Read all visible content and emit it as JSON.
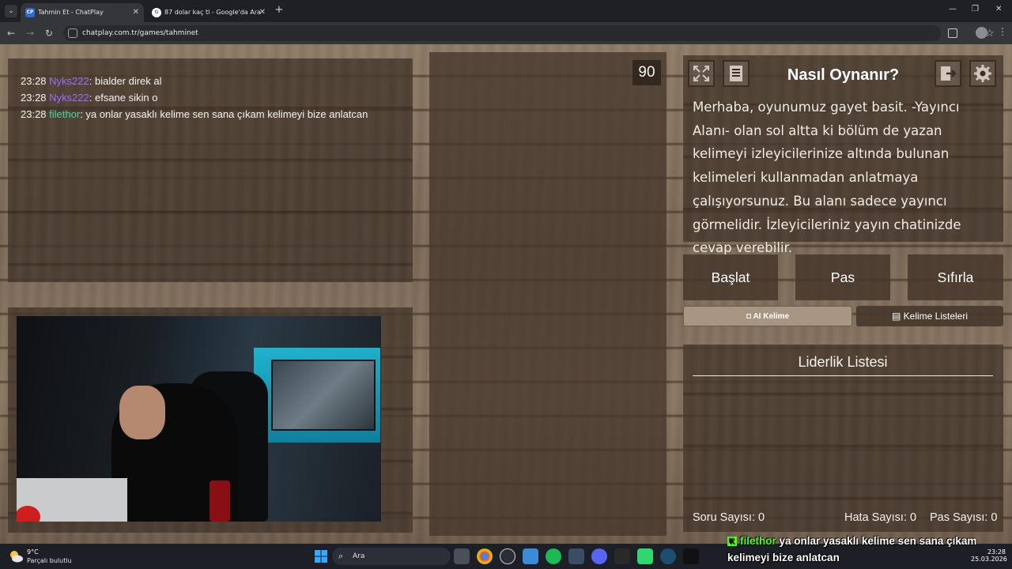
{
  "browser": {
    "tabs": [
      {
        "title": "Tahmin Et - ChatPlay",
        "favicon": "CP"
      },
      {
        "title": "87 dolar kaç tl - Google'da Ara",
        "favicon": "G"
      }
    ],
    "url": "chatplay.com.tr/games/tahminet"
  },
  "chat": {
    "messages": [
      {
        "time": "23:28",
        "user": "Nyks222",
        "user_color": "#a36bff",
        "text": ": bialder direk al"
      },
      {
        "time": "23:28",
        "user": "Nyks222",
        "user_color": "#a36bff",
        "text": ": efsane sikin o"
      },
      {
        "time": "23:28",
        "user": "filethor",
        "user_color": "#3fd7a6",
        "text": ": ya onlar yasaklı kelime sen sana çıkam kelimeyi bize anlatcan"
      }
    ]
  },
  "timer": "90",
  "help": {
    "title": "Nasıl Oynanır?",
    "text": "Merhaba, oyunumuz gayet basit. -Yayıncı Alanı- olan sol altta ki bölüm de yazan kelimeyi izleyicilerinize altında bulunan kelimeleri kullanmadan anlatmaya çalışıyorsunuz. Bu alanı sadece yayıncı görmelidir. İzleyicileriniz yayın chatinizde cevap verebilir."
  },
  "actions": {
    "start": "Başlat",
    "pass": "Pas",
    "reset": "Sıfırla"
  },
  "sub_actions": {
    "ai_word": "AI Kelime",
    "word_lists": "Kelime Listeleri"
  },
  "leaderboard": {
    "title": "Liderlik Listesi",
    "question_count_label": "Soru Sayısı:",
    "question_count": "0",
    "error_count_label": "Hata Sayısı:",
    "error_count": "0",
    "pass_count_label": "Pas Sayısı:",
    "pass_count": "0"
  },
  "overlay": {
    "user": "filethor",
    "message": "ya onlar yasaklı kelime sen sana çıkam kelimeyi bize anlatcan"
  },
  "taskbar": {
    "weather_temp": "9°C",
    "weather_desc": "Parçalı bulutlu",
    "search_placeholder": "Ara",
    "time": "23:28",
    "date": "25.03.2026"
  },
  "colors": {
    "accent_purple": "#a36bff",
    "accent_teal": "#3fd7a6",
    "kick_green": "#53fc18"
  }
}
